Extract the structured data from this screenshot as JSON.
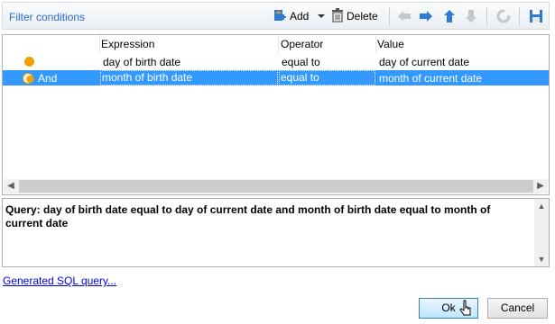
{
  "toolbar": {
    "title": "Filter conditions",
    "add_label": "Add",
    "delete_label": "Delete"
  },
  "grid": {
    "columns": [
      "Expression",
      "Operator",
      "Value"
    ],
    "rows": [
      {
        "prefix": "",
        "expression": "day of birth date",
        "operator": "equal to",
        "value": "day of current date",
        "selected": false
      },
      {
        "prefix": "And",
        "expression": "month of birth date",
        "operator": "equal to",
        "value": "month of current date",
        "selected": true
      }
    ]
  },
  "query": {
    "text": "Query: day of birth date equal to day of current date and month of birth date equal to month of current date"
  },
  "footer": {
    "sql_link": "Generated SQL query...",
    "ok_label": "Ok",
    "cancel_label": "Cancel"
  },
  "colors": {
    "accent": "#2a6ad0",
    "selection": "#3399ff",
    "condition_dot": "#f0a000"
  }
}
